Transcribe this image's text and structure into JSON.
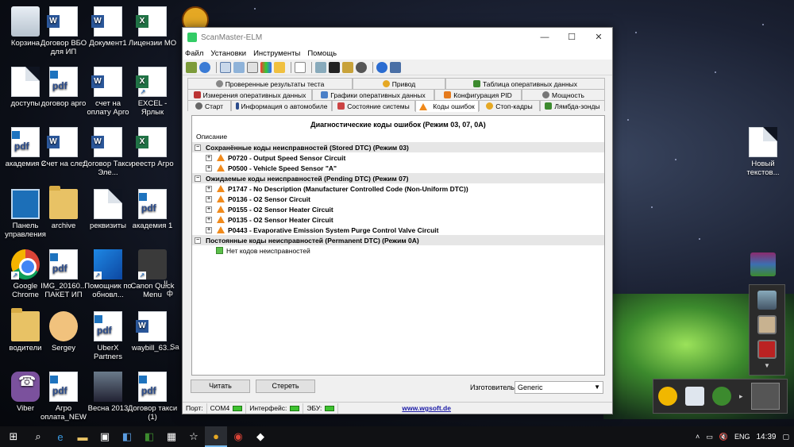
{
  "desktop": {
    "icons": [
      {
        "label": "Корзина",
        "icon": "recycle-bin-icon"
      },
      {
        "label": "Договор ВБО для ИП",
        "icon": "word-doc-icon"
      },
      {
        "label": "Документ1",
        "icon": "word-doc-icon"
      },
      {
        "label": "Лицензии МО",
        "icon": "excel-doc-icon"
      },
      {
        "label": "доступы",
        "icon": "text-doc-icon"
      },
      {
        "label": "договор арго",
        "icon": "pdf-doc-icon"
      },
      {
        "label": "счет на оплату Арго",
        "icon": "word-doc-icon"
      },
      {
        "label": "EXCEL - Ярлык",
        "icon": "excel-shortcut-icon"
      },
      {
        "label": "академия 2",
        "icon": "pdf-doc-icon"
      },
      {
        "label": "Счет на слет",
        "icon": "word-doc-icon"
      },
      {
        "label": "Договор Такси Эле...",
        "icon": "word-doc-icon"
      },
      {
        "label": "реестр Агро",
        "icon": "excel-doc-icon"
      },
      {
        "label": "Панель управления",
        "icon": "control-panel-icon"
      },
      {
        "label": "archive",
        "icon": "folder-icon"
      },
      {
        "label": "реквизиты",
        "icon": "text-doc-icon"
      },
      {
        "label": "академия 1",
        "icon": "pdf-doc-icon"
      },
      {
        "label": "Google Chrome",
        "icon": "chrome-icon"
      },
      {
        "label": "IMG_20160... ПАКЕТ ИП",
        "icon": "pdf-doc-icon"
      },
      {
        "label": "Помощник по обновл...",
        "icon": "windows-update-icon"
      },
      {
        "label": "Canon Quick Menu",
        "icon": "canon-icon"
      },
      {
        "label": "водители",
        "icon": "folder-icon"
      },
      {
        "label": "Sergey",
        "icon": "user-folder-icon"
      },
      {
        "label": "UberX Partners",
        "icon": "pdf-doc-icon"
      },
      {
        "label": "waybill_63...",
        "icon": "word-doc-icon"
      },
      {
        "label": "Viber",
        "icon": "viber-icon"
      },
      {
        "label": "Агро оплата_NEW",
        "icon": "pdf-doc-icon"
      },
      {
        "label": "Весна 2013",
        "icon": "photo-icon"
      },
      {
        "label": "Договор такси (1)",
        "icon": "pdf-doc-icon"
      },
      {
        "label": "Новый текстов...",
        "icon": "text-doc-icon"
      }
    ],
    "partial_labels": [
      "!!",
      "ф",
      "Sa"
    ]
  },
  "window": {
    "title": "ScanMaster-ELM",
    "controls": {
      "minimize": "—",
      "maximize": "☐",
      "close": "✕"
    },
    "menu": [
      "Файл",
      "Установки",
      "Инструменты",
      "Помощь"
    ],
    "tabs": {
      "row1": [
        {
          "label": "Проверенные результаты теста"
        },
        {
          "label": "Привод"
        },
        {
          "label": "Таблица оперативных данных"
        }
      ],
      "row2": [
        {
          "label": "Измерения оперативных данных"
        },
        {
          "label": "Графики оперативных данных"
        },
        {
          "label": "Конфигурация PID"
        },
        {
          "label": "Мощность"
        }
      ],
      "row3": [
        {
          "label": "Старт"
        },
        {
          "label": "Информация о автомобиле"
        },
        {
          "label": "Состояние системы"
        },
        {
          "label": "Коды ошибок"
        },
        {
          "label": "Стоп-кадры"
        },
        {
          "label": "Лямбда-зонды"
        }
      ]
    },
    "panel": {
      "title": "Диагностические коды ошибок (Режим 03, 07, 0A)",
      "column_header": "Описание",
      "groups": [
        {
          "label": "Сохранённые коды неисправностей (Stored DTC) (Режим 03)",
          "items": [
            "P0720 - Output Speed Sensor Circuit",
            "P0500 - Vehicle Speed Sensor \"A\""
          ]
        },
        {
          "label": "Ожидаемые коды неисправностей (Pending DTC) (Режим 07)",
          "items": [
            "P1747 - No Description (Manufacturer Controlled Code (Non-Uniform DTC))",
            "P0136 - O2 Sensor Circuit",
            "P0155 - O2 Sensor Heater Circuit",
            "P0135 - O2 Sensor Heater Circuit",
            "P0443 - Evaporative Emission System Purge Control Valve Circuit"
          ]
        },
        {
          "label": "Постоянные коды неисправностей (Permanent DTC) (Режим 0A)",
          "items": []
        }
      ],
      "no_codes": "Нет кодов неисправностей"
    },
    "buttons": {
      "read": "Читать",
      "clear": "Стереть"
    },
    "manufacturer": {
      "label": "Изготовитель",
      "value": "Generic"
    },
    "status": {
      "port_label": "Порт:",
      "port_value": "COM4",
      "interface_label": "Интерфейс:",
      "ecu_label": "ЭБУ:",
      "website": "www.wgsoft.de"
    }
  },
  "taskbar": {
    "language": "ENG",
    "time": "14:39"
  }
}
